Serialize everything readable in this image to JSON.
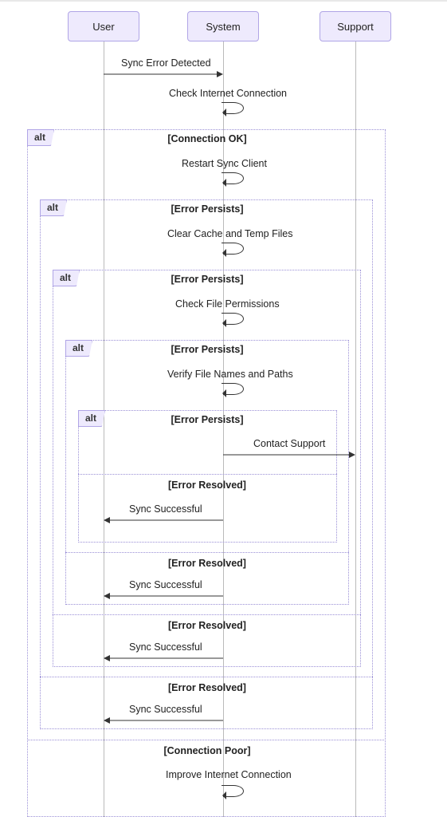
{
  "participants": {
    "user": "User",
    "system": "System",
    "support": "Support"
  },
  "messages": {
    "sync_error": "Sync Error Detected",
    "check_internet": "Check Internet Connection",
    "restart_client": "Restart Sync Client",
    "clear_cache": "Clear Cache and Temp Files",
    "check_permissions": "Check File Permissions",
    "verify_paths": "Verify File Names and Paths",
    "contact_support": "Contact Support",
    "sync_successful": "Sync Successful",
    "improve_internet": "Improve Internet Connection"
  },
  "alt": {
    "label": "alt",
    "conn_ok": "[Connection OK]",
    "error_persists": "[Error Persists]",
    "error_resolved": "[Error Resolved]",
    "conn_poor": "[Connection Poor]"
  },
  "chart_data": {
    "type": "sequence-diagram",
    "participants": [
      "User",
      "System",
      "Support"
    ],
    "interactions": [
      {
        "from": "User",
        "to": "System",
        "label": "Sync Error Detected"
      },
      {
        "from": "System",
        "to": "System",
        "label": "Check Internet Connection",
        "self": true
      },
      {
        "alt": [
          {
            "guard": "[Connection OK]",
            "body": [
              {
                "from": "System",
                "to": "System",
                "label": "Restart Sync Client",
                "self": true
              },
              {
                "alt": [
                  {
                    "guard": "[Error Persists]",
                    "body": [
                      {
                        "from": "System",
                        "to": "System",
                        "label": "Clear Cache and Temp Files",
                        "self": true
                      },
                      {
                        "alt": [
                          {
                            "guard": "[Error Persists]",
                            "body": [
                              {
                                "from": "System",
                                "to": "System",
                                "label": "Check File Permissions",
                                "self": true
                              },
                              {
                                "alt": [
                                  {
                                    "guard": "[Error Persists]",
                                    "body": [
                                      {
                                        "from": "System",
                                        "to": "System",
                                        "label": "Verify File Names and Paths",
                                        "self": true
                                      },
                                      {
                                        "alt": [
                                          {
                                            "guard": "[Error Persists]",
                                            "body": [
                                              {
                                                "from": "System",
                                                "to": "Support",
                                                "label": "Contact Support"
                                              }
                                            ]
                                          },
                                          {
                                            "guard": "[Error Resolved]",
                                            "body": [
                                              {
                                                "from": "System",
                                                "to": "User",
                                                "label": "Sync Successful"
                                              }
                                            ]
                                          }
                                        ]
                                      }
                                    ]
                                  },
                                  {
                                    "guard": "[Error Resolved]",
                                    "body": [
                                      {
                                        "from": "System",
                                        "to": "User",
                                        "label": "Sync Successful"
                                      }
                                    ]
                                  }
                                ]
                              }
                            ]
                          },
                          {
                            "guard": "[Error Resolved]",
                            "body": [
                              {
                                "from": "System",
                                "to": "User",
                                "label": "Sync Successful"
                              }
                            ]
                          }
                        ]
                      }
                    ]
                  },
                  {
                    "guard": "[Error Resolved]",
                    "body": [
                      {
                        "from": "System",
                        "to": "User",
                        "label": "Sync Successful"
                      }
                    ]
                  }
                ]
              }
            ]
          },
          {
            "guard": "[Connection Poor]",
            "body": [
              {
                "from": "System",
                "to": "System",
                "label": "Improve Internet Connection",
                "self": true
              }
            ]
          }
        ]
      }
    ]
  }
}
